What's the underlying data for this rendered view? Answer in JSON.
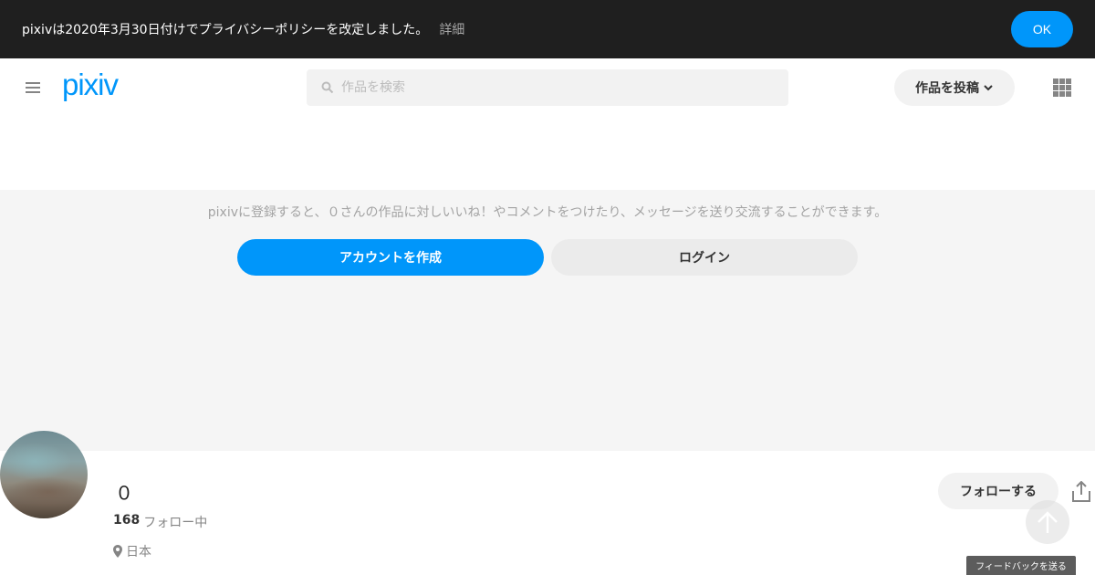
{
  "policy_banner": {
    "text": "pixivは2020年3月30日付けでプライバシーポリシーを改定しました。",
    "details_link": "詳細",
    "ok_label": "OK"
  },
  "header": {
    "logo_text": "pixiv",
    "search_placeholder": "作品を検索",
    "post_button_label": "作品を投稿",
    "icons": [
      "menu-icon",
      "search-icon",
      "chevron-down-icon",
      "grid-icon"
    ]
  },
  "register": {
    "message": "pixivに登録すると、０さんの作品に対しいいね！やコメントをつけたり、メッセージを送り交流することができます。",
    "create_account_label": "アカウントを作成",
    "login_label": "ログイン"
  },
  "profile": {
    "name": "０",
    "following_count": "168",
    "following_label": "フォロー中",
    "location": "日本",
    "follow_button_label": "フォローする"
  },
  "feedback_label": "フィードバックを送る",
  "colors": {
    "accent": "#0096fa",
    "banner_bg": "#1f1f1f",
    "cover_bg": "#f5f5f5"
  }
}
